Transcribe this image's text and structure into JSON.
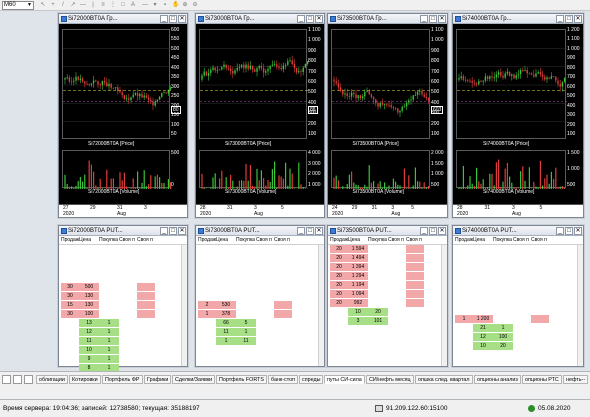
{
  "toolbar": {
    "timeframe": "M60"
  },
  "charts": [
    {
      "title": "Si72000BT0A Гр...",
      "price_label": "Si72000BT0A [Price]",
      "volume_label": "Si72000BT0A [Volume]",
      "price_ticks": [
        "600",
        "550",
        "500",
        "450",
        "400",
        "350",
        "300",
        "250",
        "200",
        "150",
        "100",
        "50"
      ],
      "volume_ticks": [
        "500",
        "0"
      ],
      "dates": [
        "27",
        "29",
        "31",
        "3"
      ],
      "date_bottom": [
        "2020",
        "",
        "Aug",
        ""
      ],
      "marker": "80"
    },
    {
      "title": "Si73000BT0A Гр...",
      "price_label": "Si73000BT0A [Price]",
      "volume_label": "Si73000BT0A [Volume]",
      "price_ticks": [
        "1 100",
        "1 000",
        "900",
        "800",
        "700",
        "600",
        "500",
        "400",
        "300",
        "200",
        "100"
      ],
      "volume_ticks": [
        "4 000",
        "3 000",
        "2 000",
        "1 000"
      ],
      "dates": [
        "28",
        "31",
        "3",
        "5"
      ],
      "date_bottom": [
        "2020",
        "",
        "Aug",
        ""
      ],
      "marker": "88"
    },
    {
      "title": "Si73500BT0A Гр...",
      "price_label": "Si73500BT0A [Price]",
      "volume_label": "Si73500BT0A [Volume]",
      "price_ticks": [
        "1 100",
        "1 000",
        "900",
        "800",
        "700",
        "600",
        "500",
        "400",
        "300",
        "200",
        "100"
      ],
      "volume_ticks": [
        "2 000",
        "1 500",
        "1 000",
        "500"
      ],
      "dates": [
        "24",
        "29",
        "31",
        "3",
        "5"
      ],
      "date_bottom": [
        "2020",
        "",
        "",
        "Aug",
        ""
      ],
      "marker": "603"
    },
    {
      "title": "Si74000BT0A Гр...",
      "price_label": "Si74000BT0A [Price]",
      "volume_label": "Si74000BT0A [Volume]",
      "price_ticks": [
        "1 200",
        "1 100",
        "1 000",
        "900",
        "800",
        "700",
        "600",
        "500",
        "400",
        "300",
        "200",
        "100"
      ],
      "volume_ticks": [
        "1 500",
        "1 000",
        "500"
      ],
      "dates": [
        "28",
        "31",
        "3",
        "5"
      ],
      "date_bottom": [
        "2020",
        "",
        "Aug",
        ""
      ],
      "marker": ""
    }
  ],
  "orderbooks": [
    {
      "title": "Si72000BT0A PUT...",
      "headers": [
        "Продаж",
        "Цена",
        "Покупка",
        "Своя п",
        "Своя п"
      ],
      "asks": [
        [
          "30",
          "500"
        ],
        [
          "30",
          "130"
        ],
        [
          "15",
          "130"
        ],
        [
          "30",
          "100"
        ]
      ],
      "bids": [
        [
          "13",
          "1"
        ],
        [
          "12",
          "1"
        ],
        [
          "11",
          "1"
        ],
        [
          "10",
          "1"
        ],
        [
          "9",
          "1"
        ],
        [
          "8",
          "1"
        ],
        [
          "7",
          "1"
        ],
        [
          "6",
          "1"
        ]
      ]
    },
    {
      "title": "Si73000BT0A PUT...",
      "headers": [
        "Продаж",
        "Цена",
        "Покупка",
        "Своя п",
        "Своя п"
      ],
      "asks": [
        [
          "2",
          "530"
        ],
        [
          "1",
          "378"
        ]
      ],
      "bids": [
        [
          "66",
          "5"
        ],
        [
          "11",
          "1"
        ],
        [
          "1",
          "11"
        ]
      ]
    },
    {
      "title": "Si73500BT0A PUT...",
      "headers": [
        "Продаж",
        "Цена",
        "Покупка",
        "Своя п",
        "Своя п"
      ],
      "asks": [
        [
          "20",
          "1 594"
        ],
        [
          "20",
          "1 494"
        ],
        [
          "20",
          "1 394"
        ],
        [
          "20",
          "1 294"
        ],
        [
          "20",
          "1 194"
        ],
        [
          "20",
          "1 094"
        ],
        [
          "20",
          "992"
        ]
      ],
      "bids": [
        [
          "10",
          "20"
        ],
        [
          "3",
          "101"
        ]
      ]
    },
    {
      "title": "Si74000BT0A PUT...",
      "headers": [
        "Продаж",
        "Цена",
        "Покупка",
        "Своя п",
        "Своя п"
      ],
      "asks": [
        [
          "1",
          "1 200"
        ]
      ],
      "bids": [
        [
          "21",
          "1"
        ],
        [
          "12",
          "100"
        ],
        [
          "10",
          "20"
        ]
      ]
    }
  ],
  "tabs": [
    "облигации",
    "Котировки",
    "Портфель ФР",
    "Графики",
    "Сделки/Заявки",
    "Портфель FORTS",
    "банк-стоп",
    "спреды",
    "путы СИ-сила",
    "СИ/нефть месяц",
    "опшка след. квартал",
    "опционы анализ",
    "опционы РТС",
    "нефть--"
  ],
  "active_tab": 8,
  "status": {
    "server_time": "Время сервера: 19:04:36; записей: 12738580; текущая: 35188197",
    "connection": "91.209.122.60:15100",
    "date": "05.08.2020"
  }
}
